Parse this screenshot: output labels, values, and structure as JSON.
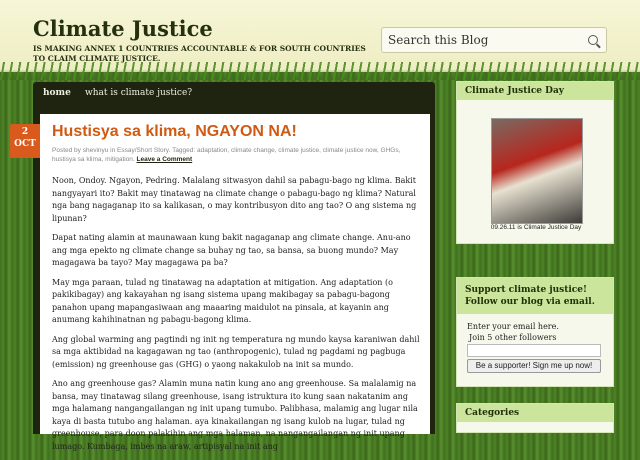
{
  "header": {
    "site_title": "Climate Justice",
    "tagline": "IS MAKING ANNEX 1 COUNTRIES ACCOUNTABLE & FOR SOUTH COUNTRIES TO CLAIM CLIMATE JUSTICE.",
    "search_placeholder": "Search this Blog"
  },
  "nav": {
    "items": [
      {
        "label": "home"
      },
      {
        "label": "what is climate justice?"
      }
    ]
  },
  "post": {
    "date_day": "2",
    "date_month": "OCT",
    "title": "Hustisya sa klima, NGAYON NA!",
    "meta": "Posted by shevinyu in Essay/Short Story. Tagged: adaptation, climate change, climate justice, climate justice now, GHGs, hustisya sa klima, mitigation.",
    "leave_comment": "Leave a Comment",
    "paragraphs": [
      "Noon, Ondoy. Ngayon, Pedring. Malalang sitwasyon dahil sa pabagu-bago ng klima. Bakit nangyayari ito? Bakit may tinatawag na climate change o pabagu-bago ng klima? Natural nga bang nagaganap ito sa kalikasan, o may kontribusyon dito ang tao? O ang sistema ng lipunan?",
      "Dapat nating alamin at maunawaan kung bakit nagaganap ang climate change. Anu-ano ang mga epekto ng climate change sa buhay ng tao, sa bansa, sa buong mundo? May magagawa ba tayo? May magagawa pa ba?",
      "May mga paraan, tulad ng tinatawag na adaptation at mitigation. Ang adaptation (o pakikibagay) ang kakayahan ng isang sistema upang makibagay sa pabagu-bagong panahon upang mapangasiwaan ang maaaring maidulot na pinsala, at kayanin ang anumang kahihinatnan ng pabagu-bagong klima.",
      "Ang global warming ang pagtindi ng init ng temperatura ng mundo kaysa karaniwan dahil sa mga aktibidad na kagagawan ng tao (anthropogenic), tulad ng pagdami ng pagbuga (emission) ng greenhouse gas (GHG) o yaong nakakulob na init sa mundo.",
      "Ano ang greenhouse gas? Alamin muna natin kung ano ang greenhouse. Sa malalamig na bansa, may tinatawag silang greenhouse, isang istruktura ito kung saan nakatanim ang mga halamang nangangailangan ng init upang tumubo. Palibhasa, malamig ang lugar nila kaya di basta tutubo ang halaman. aya kinakailangan ng isang kulob na lugar, tulad ng greenhouse, para doon palakihin ang mga halaman, na nangangailangan ng init upang lumago. Kumbaga, imbes na araw, artipisyal na init ang"
    ]
  },
  "sidebar": {
    "widget1": {
      "title": "Climate Justice Day",
      "caption": "09.26.11 is Climate Justice Day"
    },
    "widget2": {
      "title": "Support climate justice! Follow our blog via email.",
      "text1": "Enter your email here.",
      "text2": "Join 5 other followers",
      "button": "Be a supporter! Sign me up now!"
    },
    "widget3": {
      "title": "Categories"
    }
  }
}
